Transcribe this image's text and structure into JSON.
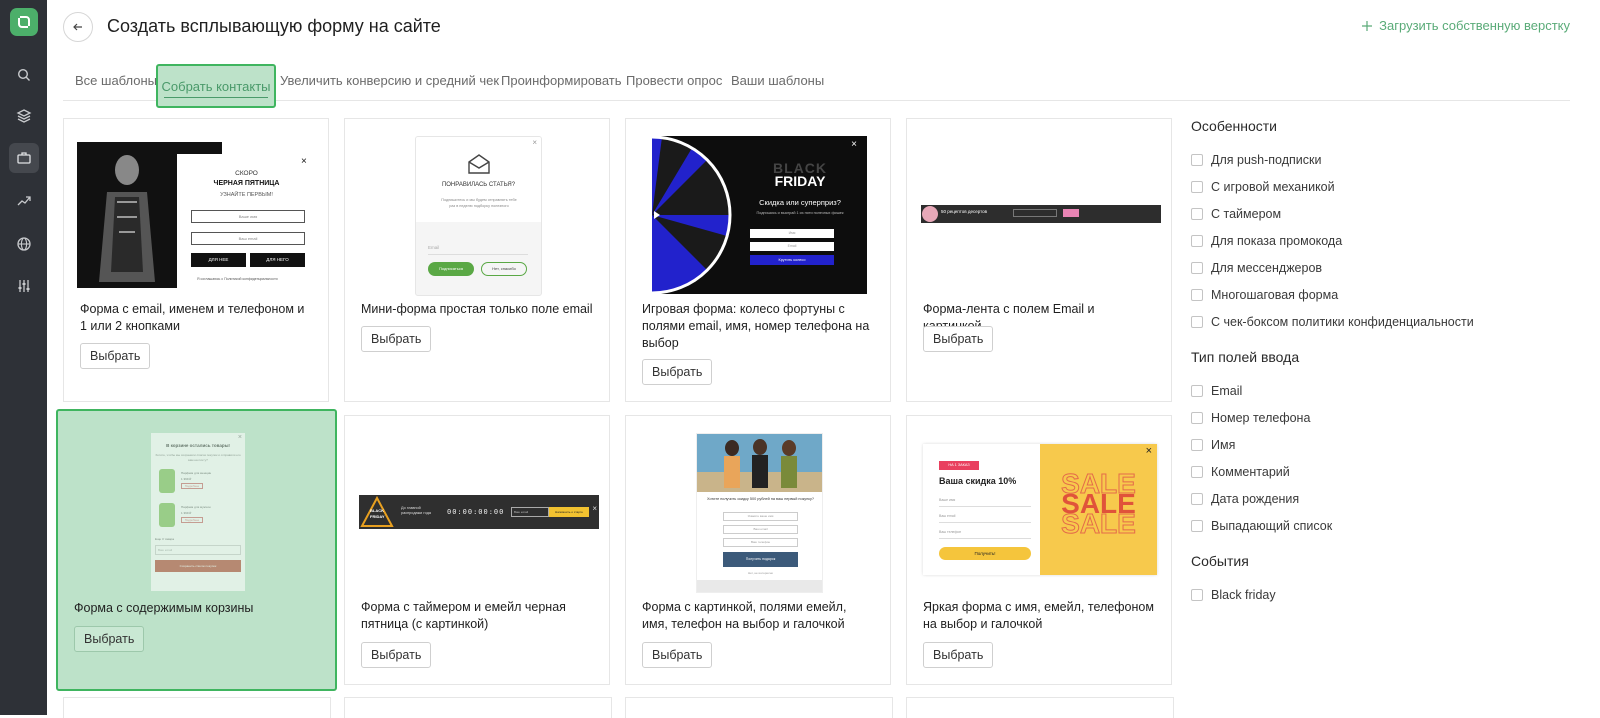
{
  "header": {
    "title": "Создать всплывающую форму на сайте",
    "upload_label": "Загрузить собственную верстку"
  },
  "tabs": [
    {
      "label": "Все шаблоны"
    },
    {
      "label": "Собрать контакты"
    },
    {
      "label": "Увеличить конверсию и средний чек"
    },
    {
      "label": "Проинформировать"
    },
    {
      "label": "Провести опрос"
    },
    {
      "label": "Ваши шаблоны"
    }
  ],
  "active_tab": "Собрать контакты",
  "cards": [
    {
      "name": "Форма с email, именем и телефоном и 1 или 2 кнопками",
      "button": "Выбрать",
      "preview": {
        "l1": "СКОРО",
        "l2": "ЧЕРНАЯ ПЯТНИЦА",
        "l3": "УЗНАЙТЕ ПЕРВЫМ!",
        "f1": "Ваше имя",
        "f2": "Ваш email",
        "b1": "ДЛЯ НЕЕ",
        "b2": "ДЛЯ НЕГО",
        "consent": "Я соглашаюсь с Политикой конфиденциальности"
      }
    },
    {
      "name": "Мини-форма простая только поле email",
      "button": "Выбрать",
      "preview": {
        "h": "ПОНРАВИЛАСЬ СТАТЬЯ?",
        "sub": "Подпишитесь и мы будем отправлять тебе раз в неделю подборку полезного",
        "field": "Email",
        "b1": "Подписаться",
        "b2": "Нет, спасибо"
      }
    },
    {
      "name": "Игровая форма: колесо фортуны с полями email, имя, номер телефона на выбор",
      "button": "Выбрать",
      "preview": {
        "t1": "BLACK",
        "t2": "FRIDAY",
        "h": "Скидка или суперприз?",
        "sub": "Подпишись и выиграй 1 из пяти полезных фишек",
        "f1": "Имя",
        "f2": "Email",
        "b": "Крутить колесо"
      }
    },
    {
      "name": "Форма-лента с полем Email и картинкой",
      "button": "Выбрать",
      "preview": {
        "t": "50 рецептов десертов"
      }
    },
    {
      "name": "Форма с содержимым корзины",
      "button": "Выбрать",
      "preview": {
        "h": "В корзине остались товары!",
        "sub": "Хотите, чтобы мы сохранили список покупок и отправили его вам на почту?",
        "i1": "Парфюм для женщин",
        "p1": "1 399 ₽",
        "i2": "Парфюм для мужчин",
        "p2": "1 399 ₽",
        "more": "Подробнее",
        "count": "Еще 3 товара",
        "field": "Ваш email",
        "b": "Сохранить список покупок"
      }
    },
    {
      "name": "Форма с таймером и емейл черная пятница (с картинкой)",
      "button": "Выбрать",
      "preview": {
        "t1": "BLACK",
        "t2": "FRIDAY",
        "txt": "До главной распродажи года",
        "digits": "00:00:00:00",
        "field": "Ваш email",
        "b": "Напомнить о старте"
      }
    },
    {
      "name": "Форма с картинкой, полями емейл, имя, телефон на выбор и галочкой",
      "button": "Выбрать",
      "preview": {
        "h": "Хотите получить скидку 500 рублей на ваш первый покупку?",
        "f1": "Укажите ваше имя",
        "f2": "Ваш email",
        "f3": "Ваш телефон",
        "b": "Получить подарок",
        "link": "Нет, не интересно"
      }
    },
    {
      "name": "Яркая форма с имя, емейл, телефоном на выбор и галочкой",
      "button": "Выбрать",
      "preview": {
        "tag": "НА 1 ЗАКАЗ",
        "h": "Ваша скидка 10%",
        "f1": "Ваше имя",
        "f2": "Ваш email",
        "f3": "Ваш телефон",
        "b": "Получить!",
        "sale": "SALE"
      }
    }
  ],
  "filters": {
    "features": {
      "title": "Особенности",
      "items": [
        "Для push-подписки",
        "С игровой механикой",
        "С таймером",
        "Для показа промокода",
        "Для мессенджеров",
        "Многошаговая форма",
        "С чек-боксом политики конфиденциальности"
      ]
    },
    "input_types": {
      "title": "Тип полей ввода",
      "items": [
        "Email",
        "Номер телефона",
        "Имя",
        "Комментарий",
        "Дата рождения",
        "Выпадающий список"
      ]
    },
    "events": {
      "title": "События",
      "items": [
        "Black friday"
      ]
    }
  },
  "colors": {
    "accent": "#4caf6a",
    "highlight_fill": "#bde2c9",
    "highlight_border": "#3fb55f",
    "sidebar": "#2e3137"
  },
  "sidebar_icons": [
    "logo-icon",
    "search-icon",
    "layers-icon",
    "briefcase-icon",
    "trend-icon",
    "globe-icon",
    "sliders-icon"
  ]
}
